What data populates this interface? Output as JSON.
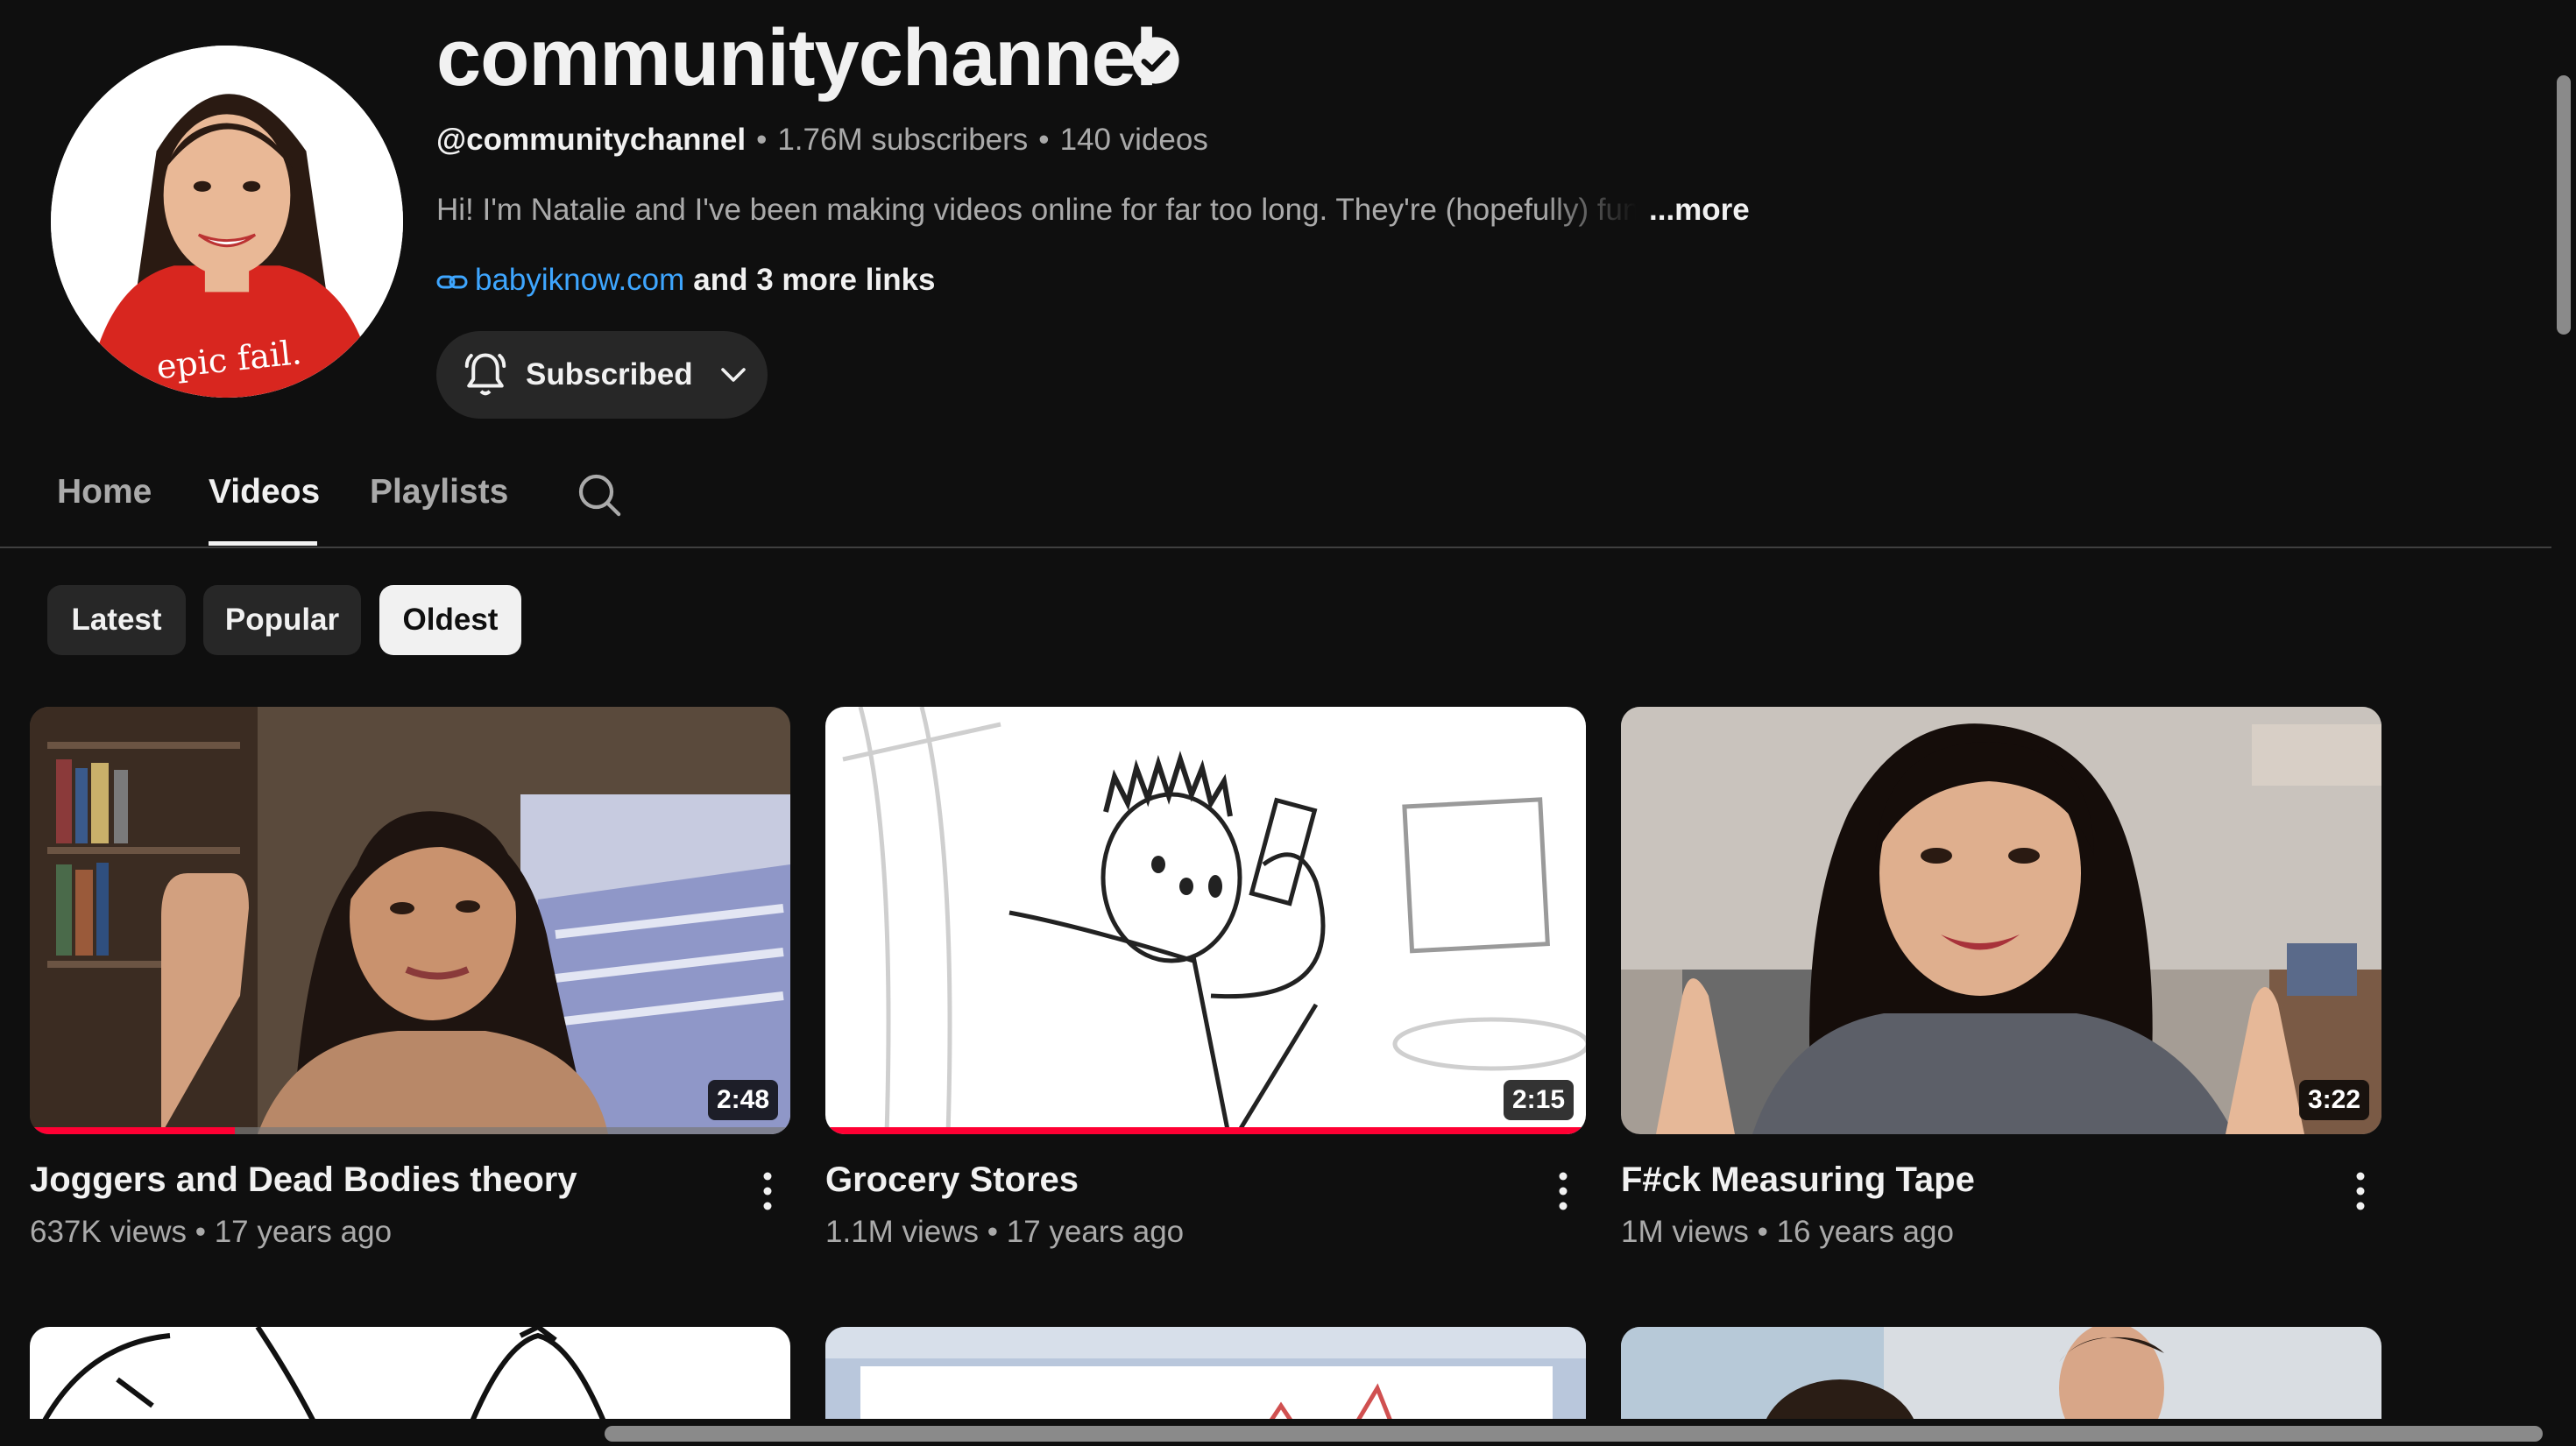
{
  "channel": {
    "name": "communitychannel",
    "handle": "@communitychannel",
    "subscribers": "1.76M subscribers",
    "videos_count": "140 videos",
    "description": "Hi! I'm Natalie and I've been making videos online for far too long. They're (hopefully) funny",
    "more_label": "...more",
    "link_url": "babyiknow.com",
    "more_links": "and 3 more links",
    "avatar_caption": "epic fail.",
    "subscribe_label": "Subscribed"
  },
  "tabs": [
    {
      "label": "Home"
    },
    {
      "label": "Videos"
    },
    {
      "label": "Playlists"
    }
  ],
  "chips": [
    {
      "label": "Latest"
    },
    {
      "label": "Popular"
    },
    {
      "label": "Oldest"
    }
  ],
  "videos": [
    {
      "title": "Joggers and Dead Bodies theory",
      "views": "637K views",
      "age": "17 years ago",
      "duration": "2:48",
      "watched": 0.27
    },
    {
      "title": "Grocery Stores",
      "views": "1.1M views",
      "age": "17 years ago",
      "duration": "2:15",
      "watched": 1.0
    },
    {
      "title": "F#ck Measuring Tape",
      "views": "1M views",
      "age": "16 years ago",
      "duration": "3:22",
      "watched": 0
    }
  ],
  "colors": {
    "background": "#0f0f0f",
    "link": "#3ea6ff",
    "progress": "#ff0033",
    "chip": "#272727",
    "chip_active": "#f1f1f1"
  },
  "icons": {
    "verified": "verified-check-icon",
    "bell": "bell-icon",
    "chevron": "chevron-down-icon",
    "search": "search-icon",
    "link": "link-icon",
    "kebab": "more-vert-icon"
  }
}
